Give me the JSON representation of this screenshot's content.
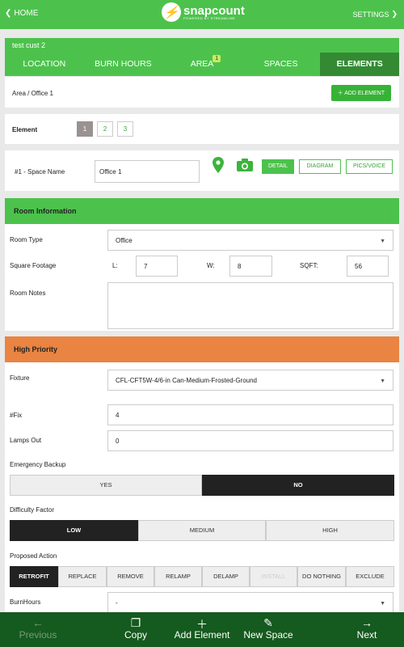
{
  "header": {
    "home_label": "HOME",
    "settings_label": "SETTINGS",
    "logo_main": "snapcount",
    "logo_sub": "POWERED BY STREAMLINE"
  },
  "customer": "test cust 2",
  "tabs": [
    {
      "label": "LOCATION"
    },
    {
      "label": "BURN HOURS"
    },
    {
      "label": "AREA",
      "badge": "1"
    },
    {
      "label": "SPACES"
    },
    {
      "label": "ELEMENTS",
      "active": true
    }
  ],
  "breadcrumb": "Area / Office 1",
  "add_element_label": "ADD ELEMENT",
  "element": {
    "label": "Element",
    "pages": [
      "1",
      "2",
      "3"
    ],
    "active_page": "1"
  },
  "space": {
    "label": "#1 - Space Name",
    "value": "Office 1",
    "buttons": {
      "detail": "DETAIL",
      "diagram": "DIAGRAM",
      "pics": "PICS/VOICE"
    }
  },
  "room": {
    "title": "Room Information",
    "type_label": "Room Type",
    "type_value": "Office",
    "sqft_label": "Square Footage",
    "l_label": "L:",
    "l_value": "7",
    "w_label": "W:",
    "w_value": "8",
    "sqft_short": "SQFT:",
    "sqft_value": "56",
    "notes_label": "Room Notes",
    "notes_value": ""
  },
  "priority": {
    "title": "High Priority",
    "fixture_label": "Fixture",
    "fixture_value": "CFL-CFT5W-4/6-in Can-Medium-Frosted-Ground",
    "fix_label": "#Fix",
    "fix_value": "4",
    "lamps_label": "Lamps Out",
    "lamps_value": "0",
    "backup_label": "Emergency Backup",
    "backup_options": [
      "YES",
      "NO"
    ],
    "backup_selected": "NO",
    "difficulty_label": "Difficulty Factor",
    "difficulty_options": [
      "LOW",
      "MEDIUM",
      "HIGH"
    ],
    "difficulty_selected": "LOW",
    "action_label": "Proposed Action",
    "action_options": [
      "RETROFIT",
      "REPLACE",
      "REMOVE",
      "RELAMP",
      "DELAMP",
      "INSTALL",
      "DO NOTHING",
      "EXCLUDE"
    ],
    "action_selected": "RETROFIT",
    "action_disabled": "INSTALL",
    "burn_label": "BurnHours",
    "burn_value": "-"
  },
  "bottom": {
    "previous": "Previous",
    "copy": "Copy",
    "add": "Add Element",
    "new_space": "New Space",
    "next": "Next"
  },
  "colors": {
    "green": "#4cc24c",
    "dark_green": "#338a33",
    "orange": "#e98442",
    "bottom_bar": "#155a1e"
  }
}
